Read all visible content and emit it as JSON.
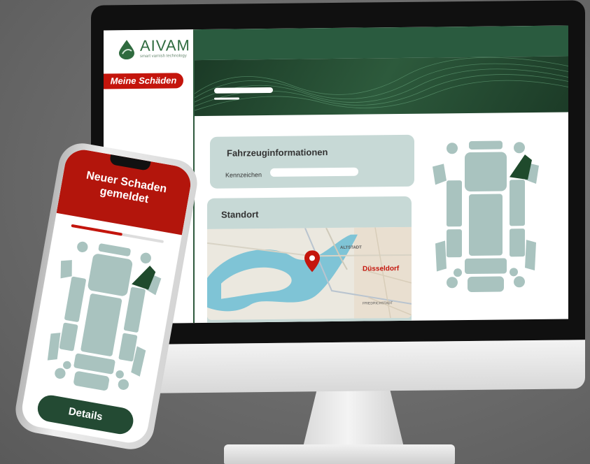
{
  "desktop": {
    "logo": {
      "name": "AIVAM",
      "tagline": "smart varnish technology"
    },
    "sidebar": {
      "active_item_label": "Meine Schäden"
    },
    "vehicle_card": {
      "title": "Fahrzeuginformationen",
      "plate_label": "Kennzeichen",
      "plate_value": ""
    },
    "location_card": {
      "title": "Standort",
      "map": {
        "city_label": "Düsseldorf",
        "district_label": "ALTSTADT",
        "district2_label": "FRIEDRICHSTADT"
      }
    }
  },
  "mobile": {
    "header_title": "Neuer Schaden gemeldet",
    "progress_fraction": 0.55,
    "details_button_label": "Details"
  },
  "colors": {
    "brand_green": "#2a5b3f",
    "alert_red": "#c4150c",
    "card_bg": "#c7d9d6",
    "damaged_part": "#1f4a2c",
    "car_parts": "#a9c3bf"
  },
  "icons": [
    "location-pin-icon",
    "car-topview-diagram-icon"
  ]
}
